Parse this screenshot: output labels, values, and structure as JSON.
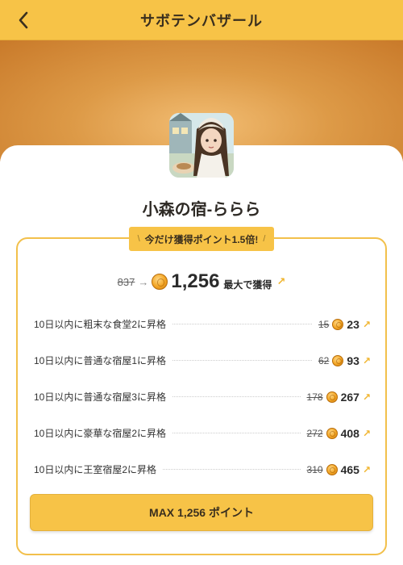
{
  "header": {
    "title": "サボテンバザール",
    "back_icon": "chevron-left-icon"
  },
  "store": {
    "name": "小森の宿-ららら"
  },
  "bonus": {
    "ribbon_text": "今だけ獲得ポイント1.5倍!",
    "ribbon_left": "\\",
    "ribbon_right": "/",
    "total_old": "837",
    "total_new": "1,256",
    "total_suffix": "最大で獲得"
  },
  "rows": [
    {
      "label": "10日以内に粗末な食堂2に昇格",
      "old": "15",
      "new": "23"
    },
    {
      "label": "10日以内に普通な宿屋1に昇格",
      "old": "62",
      "new": "93"
    },
    {
      "label": "10日以内に普通な宿屋3に昇格",
      "old": "178",
      "new": "267"
    },
    {
      "label": "10日以内に豪華な宿屋2に昇格",
      "old": "272",
      "new": "408"
    },
    {
      "label": "10日以内に王室宿屋2に昇格",
      "old": "310",
      "new": "465"
    }
  ],
  "button": {
    "max_label": "MAX 1,256 ポイント"
  },
  "colors": {
    "accent": "#f7c347",
    "hero": "#dd9a47",
    "border": "#f2c04b"
  }
}
